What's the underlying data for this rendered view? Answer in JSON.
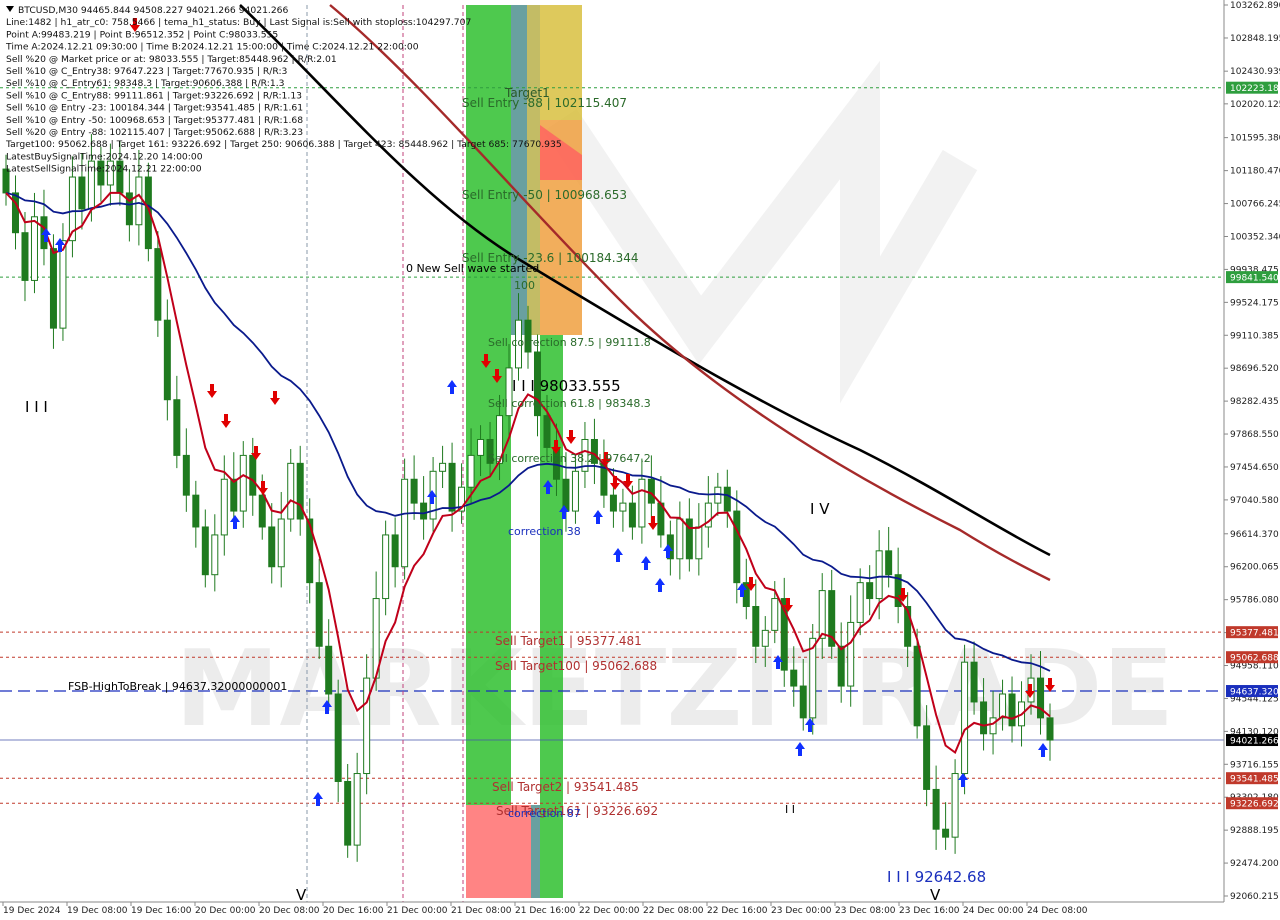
{
  "header": {
    "lines": [
      "BTCUSD,M30  94465.844 94508.227 94021.266 94021.266",
      "Line:1482 | h1_atr_c0: 758.5466 | tema_h1_status: Buy | Last Signal is:Sell with stoploss:104297.707",
      "Point A:99483.219 | Point B:96512.352 | Point C:98033.555",
      "Time A:2024.12.21 09:30:00 | Time B:2024.12.21 15:00:00 | Time C:2024.12.21 22:00:00",
      "Sell %20 @ Market price or at: 98033.555 | Target:85448.962 | R/R:2.01",
      "Sell %10 @ C_Entry38: 97647.223 | Target:77670.935 | R/R:3",
      "Sell %10 @ C_Entry61: 98348.3 | Target:90606.388 | R/R:1.3",
      "Sell %10 @ C_Entry88: 99111.861 | Target:93226.692 | R/R:1.13",
      "Sell %10 @ Entry -23: 100184.344 | Target:93541.485 | R/R:1.61",
      "Sell %10 @ Entry -50: 100968.653 | Target:95377.481 | R/R:1.68",
      "Sell %20 @ Entry -88: 102115.407 | Target:95062.688 | R/R:3.23",
      "Target100: 95062.688 | Target 161: 93226.692 | Target 250: 90606.388 | Target 423: 85448.962 | Target 685: 77670.935",
      "LatestBuySignalTime:2024.12.20 14:00:00",
      "LatestSellSignalTime:2024.12.21 22:00:00"
    ]
  },
  "y_axis": {
    "ticks": [
      "103262.890",
      "102848.195",
      "102430.939",
      "102020.125",
      "101595.380",
      "101180.470",
      "100766.245",
      "100352.340",
      "99938.475",
      "99524.175",
      "99110.385",
      "98696.520",
      "98282.435",
      "97868.550",
      "97454.650",
      "97040.580",
      "96614.370",
      "96200.065",
      "95786.080",
      "95372.065",
      "94958.110",
      "94544.125",
      "94130.120",
      "93716.155",
      "93302.180",
      "92888.195",
      "92474.200",
      "92060.215"
    ],
    "price_tags": [
      {
        "label": "102223.184",
        "value": 102223.184,
        "color": "#2e9e3e"
      },
      {
        "label": "99841.540",
        "value": 99841.54,
        "color": "#2e9e3e"
      },
      {
        "label": "95377.481",
        "value": 95377.481,
        "color": "#c0392b"
      },
      {
        "label": "95062.688",
        "value": 95062.688,
        "color": "#c0392b"
      },
      {
        "label": "94637.320",
        "value": 94637.32,
        "color": "#1a2fbd"
      },
      {
        "label": "94021.266",
        "value": 94021.266,
        "color": "#000000"
      },
      {
        "label": "93541.485",
        "value": 93541.485,
        "color": "#c0392b"
      },
      {
        "label": "93226.692",
        "value": 93226.692,
        "color": "#c0392b"
      }
    ]
  },
  "x_axis": {
    "ticks": [
      "19 Dec 2024",
      "19 Dec 08:00",
      "19 Dec 16:00",
      "20 Dec 00:00",
      "20 Dec 08:00",
      "20 Dec 16:00",
      "21 Dec 00:00",
      "21 Dec 08:00",
      "21 Dec 16:00",
      "22 Dec 00:00",
      "22 Dec 08:00",
      "22 Dec 16:00",
      "23 Dec 00:00",
      "23 Dec 08:00",
      "23 Dec 16:00",
      "24 Dec 00:00",
      "24 Dec 08:00"
    ]
  },
  "annotations": {
    "target1": "Target1",
    "sell_entry_88": "Sell Entry -88 | 102115.407",
    "sell_entry_50": "Sell Entry -50 | 100968.653",
    "sell_entry_23": "Sell Entry -23.6 | 100184.344",
    "new_sell_wave": "0 New Sell wave started",
    "label_100": "100",
    "sell_corr_875": "Sell correction 87.5 | 99111.8",
    "point_c": "I I I 98033.555",
    "sell_corr_618": "Sell correction 61.8 | 98348.3",
    "sell_corr_382": "Sell correction 38.2 | 97647.2",
    "correction_38": "correction 38",
    "sell_target1": "Sell Target1 | 95377.481",
    "sell_target100": "Sell Target100 | 95062.688",
    "sell_target2": "Sell Target2 | 93541.485",
    "sell_target161": "Sell Target161 | 93226.692",
    "correction_87": "correction 87",
    "fsb": "FSB-HighToBreak | 94637.32000000001",
    "wave_iv": "I V",
    "wave_iii_left": "I I I",
    "wave_ii": "I I",
    "wave_v": "V",
    "wave_v_left": "V",
    "wave_iii_low": "I I I 92642.68",
    "watermark": "MARKETZITRADE"
  },
  "colors": {
    "background": "#ffffff",
    "candle": "#1f7a1f",
    "ema_fast": "#c0001a",
    "ema_slow": "#0a1a8c",
    "sma_black": "#000000",
    "sma_brown": "#a52a2a",
    "green_zone": "#2fc02f",
    "buy_arrow": "#1030ff",
    "sell_arrow": "#e00000"
  },
  "chart_data": {
    "type": "candlestick",
    "title": "BTCUSD,M30",
    "ylim": [
      92060.215,
      103262.89
    ],
    "last_price": 94021.266,
    "levels": {
      "sell_entry_88": 102115.407,
      "sell_entry_50": 100968.653,
      "sell_entry_23": 100184.344,
      "sell_corr_875": 99111.8,
      "point_c": 98033.555,
      "sell_corr_618": 98348.3,
      "sell_corr_382": 97647.2,
      "sell_target1": 95377.481,
      "sell_target100": 95062.688,
      "fsb_high_to_break": 94637.32,
      "sell_target2": 93541.485,
      "sell_target161": 93226.692,
      "wave_iii_low": 92642.68
    },
    "close_series_approx": [
      100900,
      100400,
      99800,
      100600,
      100200,
      99200,
      100300,
      101100,
      100700,
      101300,
      101000,
      101300,
      100900,
      100500,
      101100,
      100200,
      99300,
      98300,
      97600,
      97100,
      96700,
      96100,
      96600,
      97300,
      96900,
      97600,
      97100,
      96700,
      96200,
      96800,
      97500,
      96800,
      96000,
      95200,
      94600,
      93500,
      92700,
      93600,
      94800,
      95800,
      96600,
      96200,
      97300,
      97000,
      96800,
      97400,
      97500,
      96900,
      97200,
      97600,
      97800,
      97500,
      98100,
      98700,
      99300,
      98900,
      98100,
      97700,
      97300,
      96900,
      97400,
      97800,
      97500,
      97100,
      96900,
      97000,
      96700,
      97300,
      97000,
      96600,
      96300,
      96800,
      96300,
      96700,
      97000,
      97200,
      96900,
      96000,
      95700,
      95200,
      95400,
      95800,
      94900,
      94700,
      94300,
      95300,
      95900,
      95200,
      94700,
      95500,
      96000,
      95800,
      96400,
      96100,
      95700,
      95200,
      94200,
      93400,
      92900,
      92800,
      93600,
      95000,
      94500,
      94100,
      94300,
      94600,
      94200,
      94500,
      94800,
      94300,
      94021
    ]
  }
}
